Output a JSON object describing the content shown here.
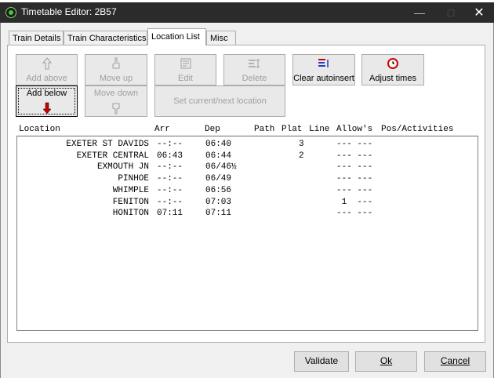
{
  "window": {
    "title": "Timetable Editor: 2B57"
  },
  "tabs": [
    {
      "label": "Train Details"
    },
    {
      "label": "Train Characteristics"
    },
    {
      "label": "Location List"
    },
    {
      "label": "Misc"
    }
  ],
  "toolbar": {
    "add_above": "Add above",
    "add_below": "Add below",
    "move_up": "Move up",
    "move_down": "Move down",
    "edit": "Edit",
    "delete": "Delete",
    "clear_autoinsert": "Clear autoinsert",
    "adjust_times": "Adjust times",
    "set_current": "Set current/next location"
  },
  "table": {
    "headers": [
      "Location",
      "Arr",
      "Dep",
      "Path",
      "Plat",
      "Line",
      "Allow's",
      "Pos/Activities"
    ],
    "rows": [
      {
        "location": "EXETER ST DAVIDS",
        "arr": "--:--",
        "dep": "06:40",
        "path": "",
        "plat": "3",
        "line": "",
        "allow": "--- ---",
        "pos": ""
      },
      {
        "location": "EXETER CENTRAL",
        "arr": "06:43",
        "dep": "06:44",
        "path": "",
        "plat": "2",
        "line": "",
        "allow": "--- ---",
        "pos": ""
      },
      {
        "location": "EXMOUTH JN",
        "arr": "--:--",
        "dep": "06/46½",
        "path": "",
        "plat": "",
        "line": "",
        "allow": "--- ---",
        "pos": ""
      },
      {
        "location": "PINHOE",
        "arr": "--:--",
        "dep": "06/49",
        "path": "",
        "plat": "",
        "line": "",
        "allow": "--- ---",
        "pos": ""
      },
      {
        "location": "WHIMPLE",
        "arr": "--:--",
        "dep": "06:56",
        "path": "",
        "plat": "",
        "line": "",
        "allow": "--- ---",
        "pos": ""
      },
      {
        "location": "FENITON",
        "arr": "--:--",
        "dep": "07:03",
        "path": "",
        "plat": "",
        "line": "",
        "allow": " 1  ---",
        "pos": ""
      },
      {
        "location": "HONITON",
        "arr": "07:11",
        "dep": "07:11",
        "path": "",
        "plat": "",
        "line": "",
        "allow": "--- ---",
        "pos": ""
      }
    ]
  },
  "buttons": {
    "validate": "Validate",
    "ok": "Ok",
    "cancel": "Cancel"
  },
  "colors": {
    "titlebar": "#2b2b2b",
    "arrow": "#cc0000",
    "clear_blue": "#1f3fbf",
    "clear_red": "#d00000"
  }
}
